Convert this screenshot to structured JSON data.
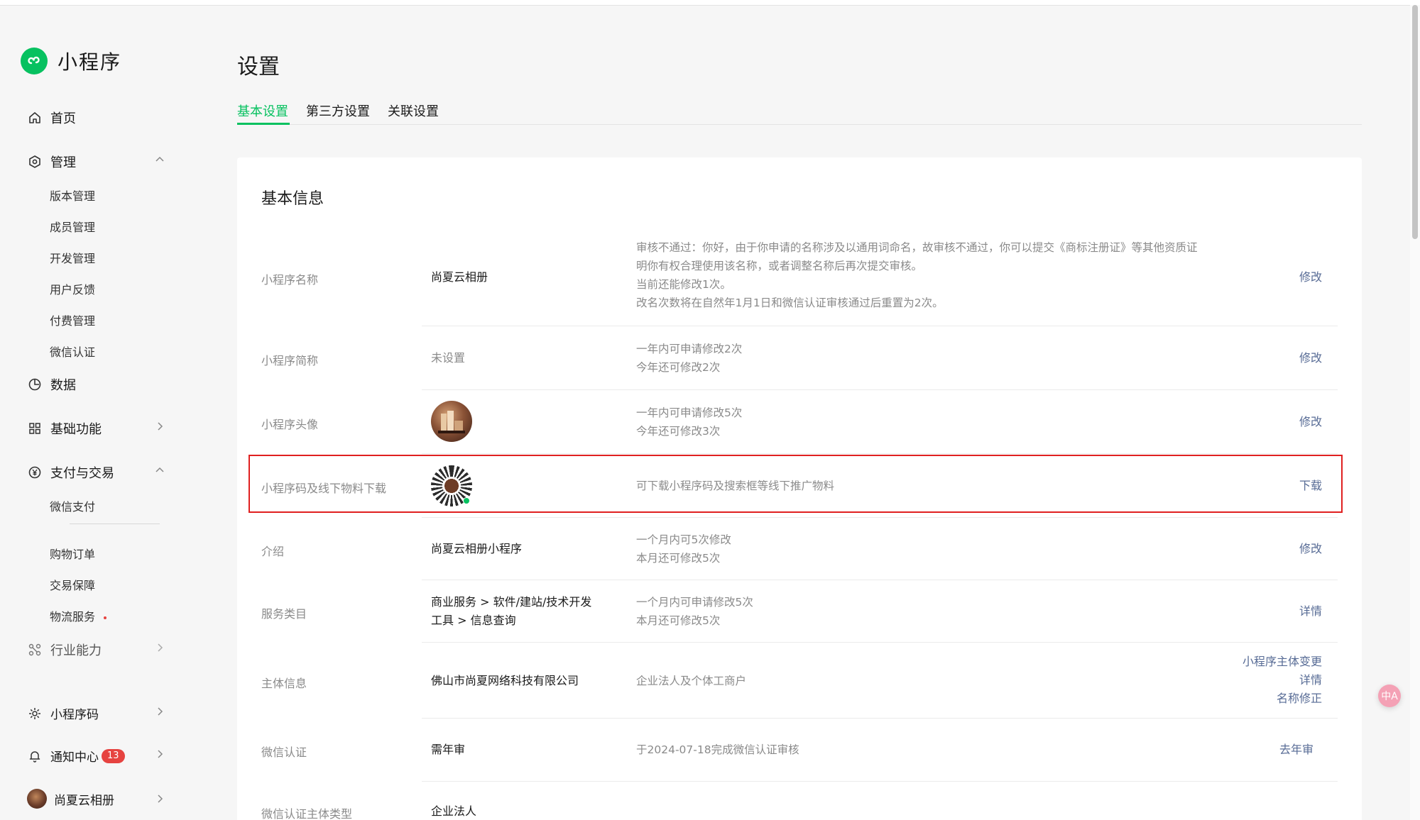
{
  "brand": {
    "name": "小程序"
  },
  "sidebar": {
    "home": "首页",
    "manage": "管理",
    "manage_items": [
      "版本管理",
      "成员管理",
      "开发管理",
      "用户反馈",
      "付费管理",
      "微信认证"
    ],
    "data": "数据",
    "basic_features": "基础功能",
    "payment": "支付与交易",
    "payment_items": [
      "微信支付",
      "购物订单",
      "交易保障",
      "物流服务"
    ],
    "industry": "行业能力",
    "mini_code": "小程序码",
    "notifications": "通知中心",
    "notifications_count": "13",
    "account": "尚夏云相册"
  },
  "page": {
    "title": "设置",
    "tabs": [
      "基本设置",
      "第三方设置",
      "关联设置"
    ],
    "active_tab": "基本设置"
  },
  "card": {
    "title": "基本信息",
    "rows": [
      {
        "label": "小程序名称",
        "value": "尚夏云相册",
        "desc": [
          "审核不通过：你好，由于你申请的名称涉及以通用词命名，故审核不通过，你可以提交《商标注册证》等其他资质证",
          "明你有权合理使用该名称，或者调整名称后再次提交审核。",
          "当前还能修改1次。",
          "改名次数将在自然年1月1日和微信认证审核通过后重置为2次。"
        ],
        "action": "修改"
      },
      {
        "label": "小程序简称",
        "value": "未设置",
        "desc": [
          "一年内可申请修改2次",
          "今年还可修改2次"
        ],
        "action": "修改"
      },
      {
        "label": "小程序头像",
        "desc": [
          "一年内可申请修改5次",
          "今年还可修改3次"
        ],
        "action": "修改"
      },
      {
        "label": "小程序码及线下物料下载",
        "desc": [
          "可下载小程序码及搜索框等线下推广物料"
        ],
        "action": "下载"
      },
      {
        "label": "介绍",
        "value": "尚夏云相册小程序",
        "desc": [
          "一个月内可5次修改",
          "本月还可修改5次"
        ],
        "action": "修改"
      },
      {
        "label": "服务类目",
        "value": [
          "商业服务 > 软件/建站/技术开发",
          "工具 > 信息查询"
        ],
        "desc": [
          "一个月内可申请修改5次",
          "本月还可修改5次"
        ],
        "action": "详情"
      },
      {
        "label": "主体信息",
        "value": "佛山市尚夏网络科技有限公司",
        "desc": [
          "企业法人及个体工商户"
        ],
        "actions": [
          "小程序主体变更",
          "详情",
          "名称修正"
        ]
      },
      {
        "label": "微信认证",
        "value": "需年审",
        "desc": [
          "于2024-07-18完成微信认证审核"
        ],
        "action": "去年审"
      },
      {
        "label": "微信认证主体类型",
        "value": "企业法人"
      }
    ]
  },
  "translate_fab": "中A",
  "colors": {
    "accent": "#07c160",
    "link": "#576b95",
    "highlight": "#e02020"
  }
}
